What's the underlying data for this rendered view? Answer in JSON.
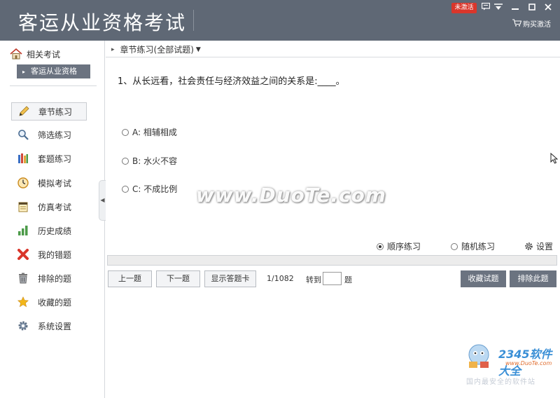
{
  "app": {
    "title": "客运从业资格考试",
    "badge": "未激活",
    "buy_label": "购买激活",
    "icons": {
      "message": "message-icon",
      "menu": "menu-icon",
      "minimize": "minimize-icon",
      "maximize": "maximize-icon",
      "close": "close-icon",
      "cart": "cart-icon"
    }
  },
  "sidebar": {
    "related_title": "相关考试",
    "subject": "客运从业资格",
    "items": [
      {
        "label": "章节练习",
        "icon": "pencil-icon",
        "active": true
      },
      {
        "label": "筛选练习",
        "icon": "magnifier-icon"
      },
      {
        "label": "套题练习",
        "icon": "books-icon"
      },
      {
        "label": "模拟考试",
        "icon": "clock-icon"
      },
      {
        "label": "仿真考试",
        "icon": "notepad-icon"
      },
      {
        "label": "历史成绩",
        "icon": "bar-chart-icon"
      },
      {
        "label": "我的错题",
        "icon": "red-x-icon"
      },
      {
        "label": "排除的题",
        "icon": "trash-icon"
      },
      {
        "label": "收藏的题",
        "icon": "star-icon"
      },
      {
        "label": "系统设置",
        "icon": "gear-icon"
      }
    ]
  },
  "main": {
    "breadcrumb": "章节练习(全部试题)",
    "question": "1、从长远看，社会责任与经济效益之间的关系是:____。",
    "options": [
      "A: 相辅相成",
      "B: 水火不容",
      "C: 不成比例"
    ],
    "watermark": "www.DuoTe.com",
    "modes": {
      "sequential": "顺序练习",
      "random": "随机练习",
      "settings": "设置",
      "selected": "sequential"
    },
    "buttons": {
      "prev": "上一题",
      "next": "下一题",
      "answer_card": "显示答题卡",
      "favorite": "收藏试题",
      "exclude": "排除此题"
    },
    "counter": "1/1082",
    "goto_label": "转到",
    "goto_unit": "题"
  },
  "corner_logo": {
    "brand": "2345软件大全",
    "url": "www.DuoTe.com",
    "tagline": "国内最安全的软件站"
  },
  "colors": {
    "titlebar": "#5f6875",
    "accent_dark": "#6b7380",
    "badge_red": "#d9362b"
  }
}
